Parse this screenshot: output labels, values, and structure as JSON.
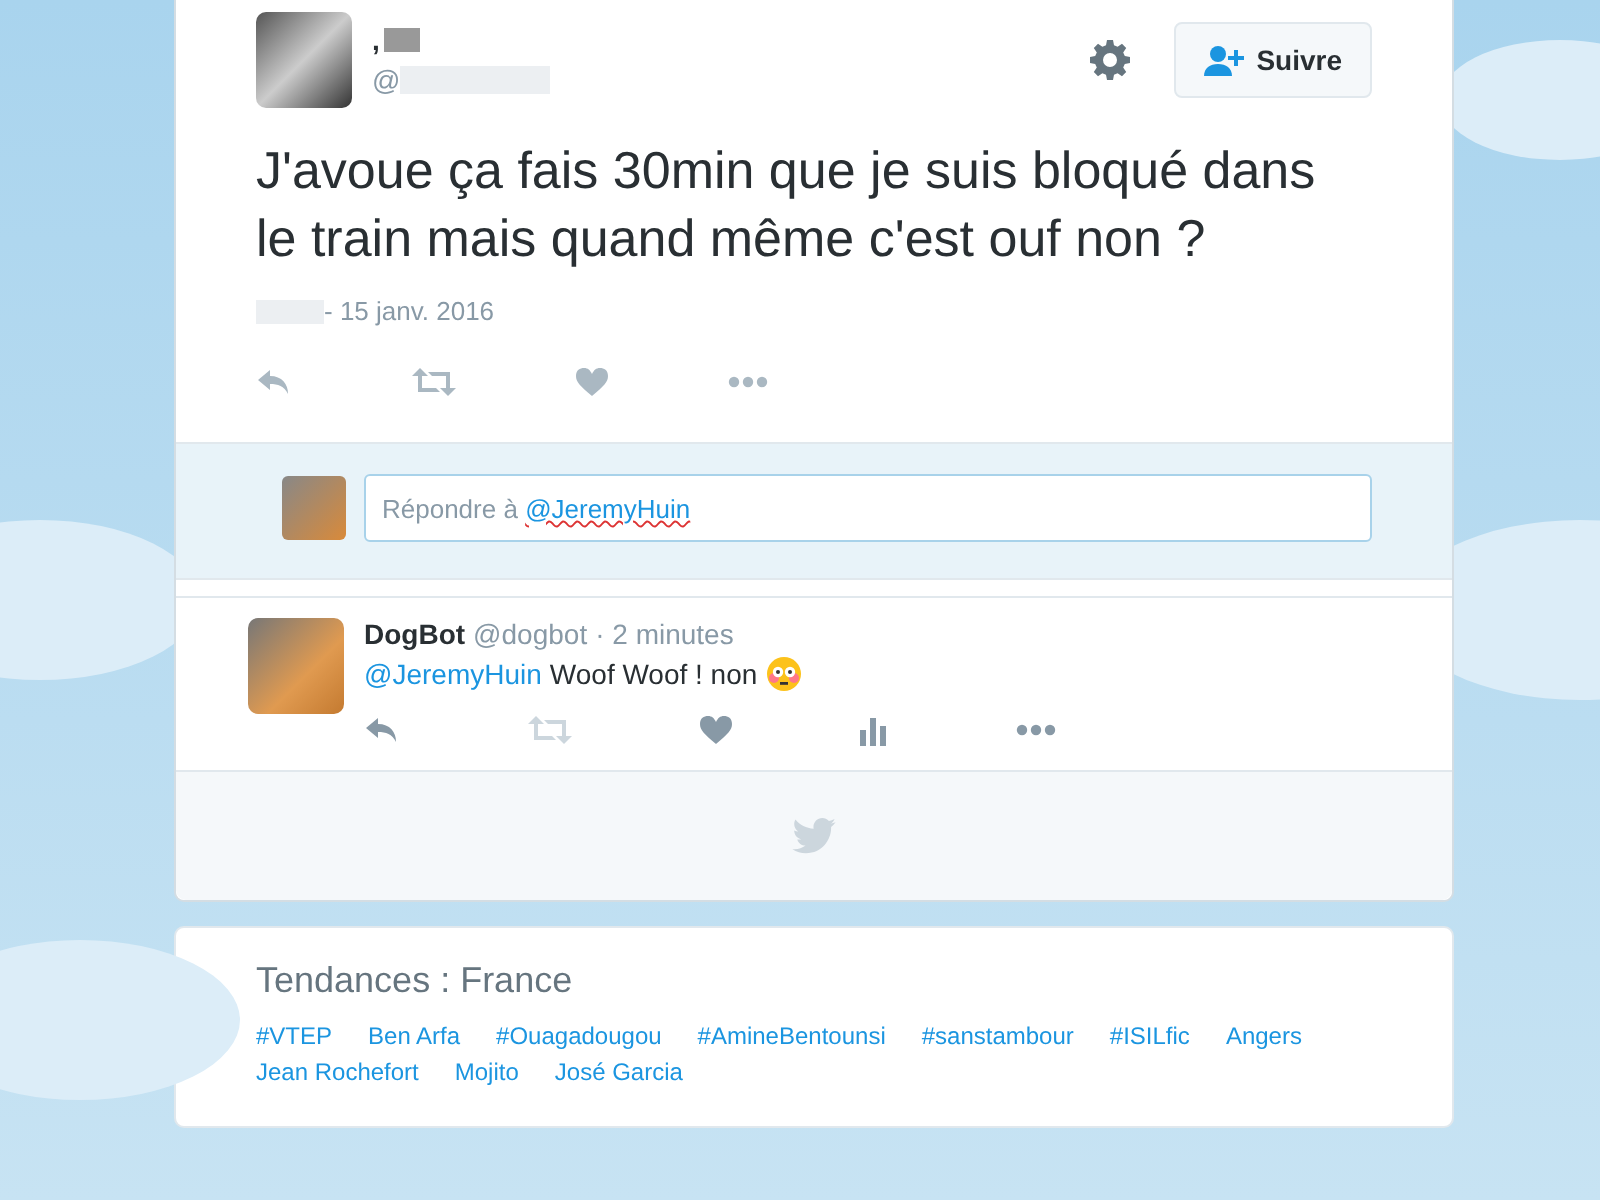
{
  "tweet": {
    "name": ",",
    "handle": "@",
    "text": "J'avoue ça fais 30min que je suis bloqué dans le train mais quand même c'est ouf non ?",
    "date": "- 15 janv. 2016",
    "follow_button": "Suivre"
  },
  "reply_box": {
    "placeholder": "Répondre à ",
    "mention": "@JeremyHuin"
  },
  "replies": [
    {
      "name": "DogBot",
      "handle": "@dogbot",
      "time": "· 2 minutes",
      "mention": "@JeremyHuin",
      "text": "Woof Woof ! non"
    }
  ],
  "trends": {
    "title": "Tendances : France",
    "items": [
      "#VTEP",
      "Ben Arfa",
      "#Ouagadougou",
      "#AmineBentounsi",
      "#sanstambour",
      "#ISILfic",
      "Angers",
      "Jean Rochefort",
      "Mojito",
      "José Garcia"
    ]
  }
}
